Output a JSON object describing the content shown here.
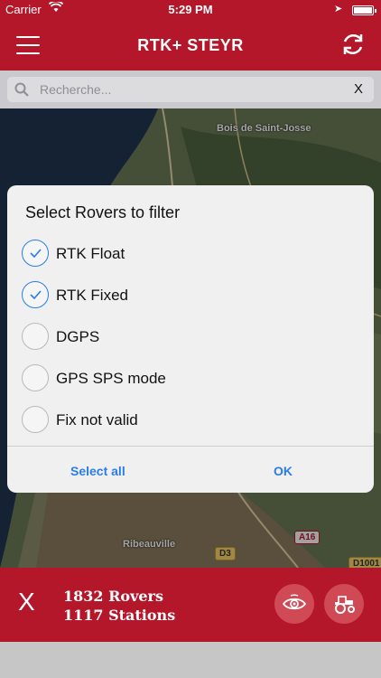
{
  "status_bar": {
    "carrier": "Carrier",
    "time": "5:29 PM"
  },
  "header": {
    "title": "RTK+ STEYR",
    "menu_icon": "hamburger-menu-icon",
    "refresh_icon": "refresh-icon"
  },
  "search": {
    "placeholder": "Recherche...",
    "clear_label": "X"
  },
  "map": {
    "labels": {
      "bois": "Bois de Saint-Josse",
      "ribeauville": "Ribeauville"
    },
    "roads": {
      "d3": "D3",
      "a16": "A16",
      "d1001": "D1001"
    }
  },
  "dialog": {
    "title": "Select Rovers to filter",
    "options": [
      {
        "label": "RTK Float",
        "checked": true
      },
      {
        "label": "RTK Fixed",
        "checked": true
      },
      {
        "label": "DGPS",
        "checked": false
      },
      {
        "label": "GPS SPS mode",
        "checked": false
      },
      {
        "label": "Fix not valid",
        "checked": false
      }
    ],
    "select_all_label": "Select all",
    "ok_label": "OK"
  },
  "bottom": {
    "close_label": "X",
    "rovers": "1832 Rovers",
    "stations": "1117 Stations",
    "eye_icon": "eye-icon",
    "tractor_icon": "tractor-icon"
  },
  "colors": {
    "brand": "#b5172a",
    "accent": "#2a7de8"
  }
}
